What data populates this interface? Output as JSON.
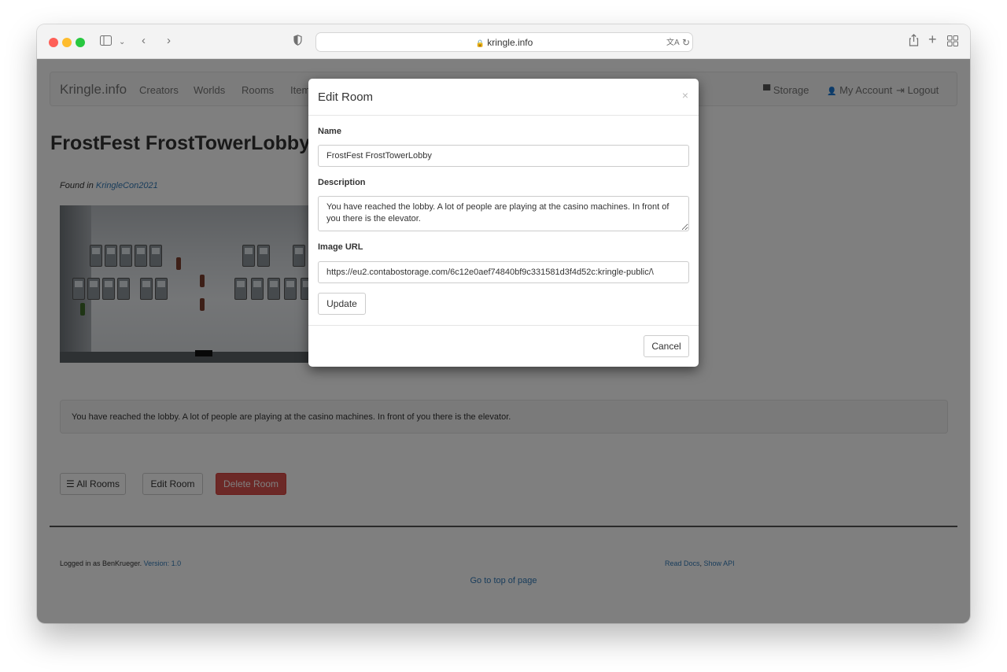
{
  "browser": {
    "url": "kringle.info",
    "lock_icon": "🔒",
    "icons": [
      "sidebar-icon",
      "chevron-down-icon",
      "back-icon",
      "forward-icon",
      "shield-icon",
      "translate-icon",
      "reload-icon",
      "share-icon",
      "new-tab-icon",
      "tab-overview-icon"
    ]
  },
  "navbar": {
    "brand": "Kringle.info",
    "items": [
      "Creators",
      "Worlds",
      "Rooms",
      "Item"
    ],
    "right_items": [
      {
        "label": "Storage",
        "icon": "storage-icon",
        "glyph": "▀"
      },
      {
        "label": "My Account",
        "icon": "user-icon",
        "glyph": "👤"
      },
      {
        "label": "Logout",
        "icon": "logout-icon",
        "glyph": "⇥"
      }
    ]
  },
  "page": {
    "title": "FrostFest FrostTowerLobby",
    "found_prefix": "Found in ",
    "found_link": "KringleCon2021",
    "description": "You have reached the lobby. A lot of people are playing at the casino machines. In front of you there is the elevator.",
    "buttons": {
      "all_rooms": "All Rooms",
      "all_rooms_icon": "☰",
      "edit_room": "Edit Room",
      "delete_room": "Delete Room"
    },
    "footer": {
      "logged_in": "Logged in as BenKrueger.",
      "version": "Version: 1.0",
      "read_docs": "Read Docs",
      "separator": ", ",
      "show_api": "Show API",
      "go_top": "Go to top of page"
    }
  },
  "modal": {
    "title": "Edit Room",
    "close": "×",
    "name_label": "Name",
    "name_value": "FrostFest FrostTowerLobby",
    "description_label": "Description",
    "description_value": "You have reached the lobby. A lot of people are playing at the casino machines. In front of you there is the elevator.",
    "image_label": "Image URL",
    "image_value": "https://eu2.contabostorage.com/6c12e0aef74840bf9c331581d3f4d52c:kringle-public/\\",
    "update_button": "Update",
    "cancel_button": "Cancel"
  },
  "colors": {
    "danger": "#d9534f",
    "link": "#337ab7"
  }
}
